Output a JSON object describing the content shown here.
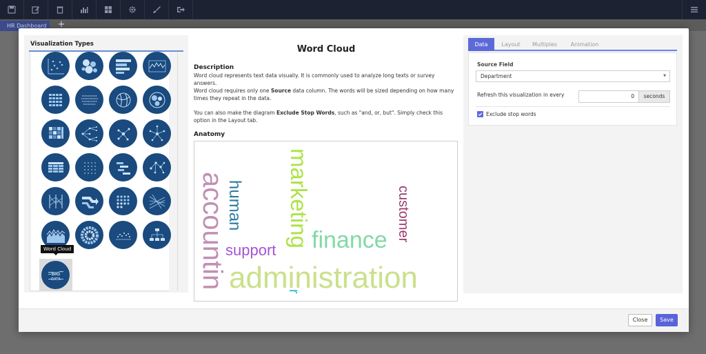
{
  "toolbar": {
    "icons": [
      "save-icon",
      "edit-icon",
      "trash-icon",
      "bar-chart-icon",
      "dashboard-icon",
      "gear-icon",
      "brush-icon",
      "export-icon",
      "menu-icon"
    ]
  },
  "dashboard_tab": {
    "label": "HR Dashboard",
    "add_label": "+"
  },
  "vis_types": {
    "title": "Visualization Types",
    "tooltip": "Word Cloud"
  },
  "description": {
    "title": "Word Cloud",
    "heading": "Description",
    "p1": "Word cloud represents text data visually. It is commonly used to analyze long texts or survey answers.",
    "p2_before": "Word cloud requires only one ",
    "p2_bold": "Source",
    "p2_after": " data column. The words will be sized depending on how many times they repeat in the data.",
    "p3_before": "You can also make the diagram ",
    "p3_bold": "Exclude Stop Words",
    "p3_after": ", such as \"and, or, but\". Simply check this option in the Layout tab.",
    "anatomy_heading": "Anatomy"
  },
  "wordcloud": {
    "words": [
      {
        "text": "accountin",
        "color": "#c18fb3"
      },
      {
        "text": "human",
        "color": "#2e7ba0"
      },
      {
        "text": "support",
        "color": "#a552d6"
      },
      {
        "text": "marketing",
        "color": "#aee34a"
      },
      {
        "text": "finance",
        "color": "#82d9a6"
      },
      {
        "text": "customer",
        "color": "#9a3c6e"
      },
      {
        "text": "administration",
        "color": "#cbe08a"
      },
      {
        "text": "r",
        "color": "#22b5e0"
      }
    ]
  },
  "tabs": {
    "data": "Data",
    "layout": "Layout",
    "multiples": "Multiples",
    "animation": "Animation",
    "active": "Data"
  },
  "props": {
    "source_field_label": "Source Field",
    "source_field_value": "Department",
    "refresh_label": "Refresh this visualization in every",
    "refresh_value": "0",
    "refresh_unit": "seconds",
    "exclude_label": "Exclude stop words",
    "exclude_checked": true
  },
  "footer": {
    "close_label": "Close",
    "save_label": "Save"
  },
  "colors": {
    "accent": "#5c6ad8",
    "icon_bg": "#1a4a7e",
    "toolbar": "#1d2233"
  }
}
